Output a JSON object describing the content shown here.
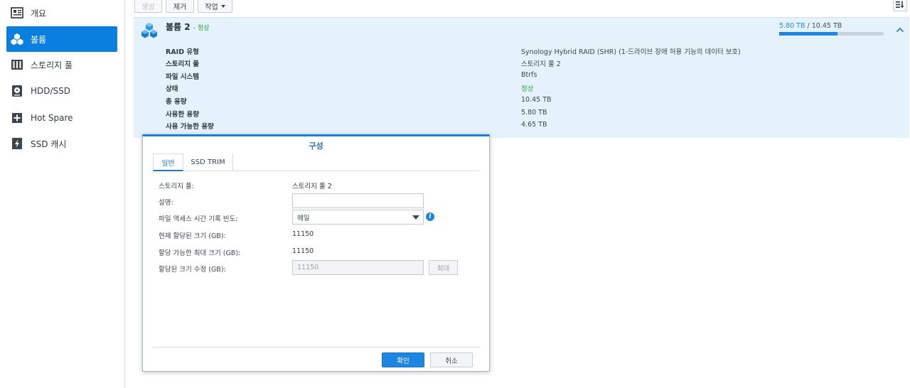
{
  "sidebar": {
    "items": [
      {
        "label": "개요",
        "icon": "overview-icon"
      },
      {
        "label": "볼륨",
        "icon": "volume-icon",
        "active": true
      },
      {
        "label": "스토리지 풀",
        "icon": "storage-pool-icon"
      },
      {
        "label": "HDD/SSD",
        "icon": "hdd-icon"
      },
      {
        "label": "Hot Spare",
        "icon": "hot-spare-icon"
      },
      {
        "label": "SSD 캐시",
        "icon": "ssd-cache-icon"
      }
    ]
  },
  "toolbar": {
    "create_label": "생성",
    "remove_label": "제거",
    "action_label": "작업"
  },
  "volume": {
    "name": "볼륨 2",
    "status_inline": "- 정상",
    "used": "5.80 TB",
    "total": "/ 10.45 TB",
    "usage_fraction": 0.555,
    "details": [
      {
        "key": "RAID 유형",
        "value": "Synology Hybrid RAID (SHR) (1-드라이브 장애 허용 기능의 데이터 보호)"
      },
      {
        "key": "스토리지 풀",
        "value": "스토리지 풀 2"
      },
      {
        "key": "파일 시스템",
        "value": "Btrfs"
      },
      {
        "key": "상태",
        "value": "정상",
        "ok": true
      },
      {
        "key": "총 용량",
        "value": "10.45 TB"
      },
      {
        "key": "사용한 용량",
        "value": "5.80 TB"
      },
      {
        "key": "사용 가능한 용량",
        "value": "4.65 TB"
      }
    ]
  },
  "dialog": {
    "title": "구성",
    "tabs": [
      "일반",
      "SSD TRIM"
    ],
    "fields": {
      "storage_pool_label": "스토리지 풀:",
      "storage_pool_value": "스토리지 풀 2",
      "description_label": "설명:",
      "description_value": "",
      "access_time_label": "파일 액세스 시간 기록 빈도:",
      "access_time_value": "매일",
      "current_size_label": "현재 할당된 크기 (GB):",
      "current_size_value": "11150",
      "max_size_label": "할당 가능한 최대 크기 (GB):",
      "max_size_value": "11150",
      "modify_size_label": "할당된 크기 수정 (GB):",
      "modify_size_value": "11150"
    },
    "max_button": "최대",
    "ok_button": "확인",
    "cancel_button": "취소"
  },
  "colors": {
    "accent": "#1e86e0",
    "status_ok": "#24a23e",
    "panel_bg": "#e6f2fb"
  }
}
